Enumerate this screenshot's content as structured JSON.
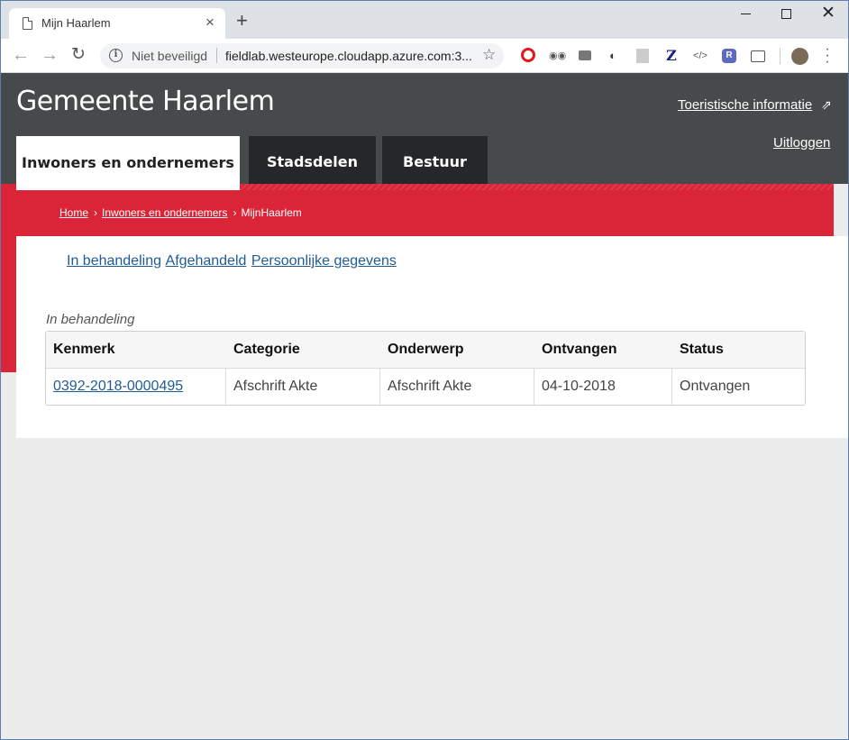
{
  "browser": {
    "tab_title": "Mijn Haarlem",
    "security_label": "Niet beveiligd",
    "url": "fieldlab.westeurope.cloudapp.azure.com:3..."
  },
  "header": {
    "site_title": "Gemeente Haarlem",
    "tourist_link": "Toeristische informatie",
    "logout_link": "Uitloggen",
    "nav_tabs": [
      "Inwoners en ondernemers",
      "Stadsdelen",
      "Bestuur"
    ],
    "accent_color": "#da2539"
  },
  "breadcrumb": {
    "items": [
      "Home",
      "Inwoners en ondernemers",
      "MijnHaarlem"
    ]
  },
  "subnav": {
    "links": [
      "In behandeling",
      "Afgehandeld",
      "Persoonlijke gegevens"
    ]
  },
  "cases": {
    "caption": "In behandeling",
    "columns": [
      "Kenmerk",
      "Categorie",
      "Onderwerp",
      "Ontvangen",
      "Status"
    ],
    "rows": [
      {
        "kenmerk": "0392-2018-0000495",
        "categorie": "Afschrift Akte",
        "onderwerp": "Afschrift Akte",
        "ontvangen": "04-10-2018",
        "status": "Ontvangen"
      }
    ]
  }
}
